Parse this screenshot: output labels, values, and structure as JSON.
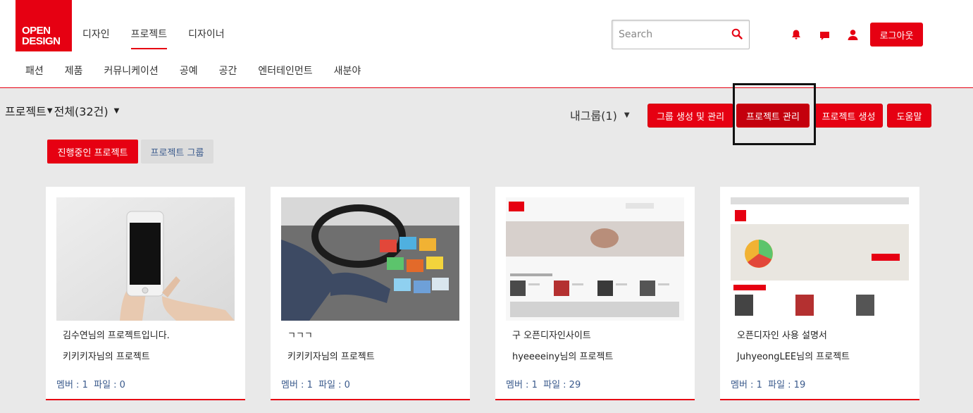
{
  "logo": {
    "line1": "OPEN",
    "line2": "DESIGN"
  },
  "main_nav": [
    {
      "label": "디자인",
      "active": false
    },
    {
      "label": "프로젝트",
      "active": true
    },
    {
      "label": "디자이너",
      "active": false
    }
  ],
  "sub_nav": [
    "패션",
    "제품",
    "커뮤니케이션",
    "공예",
    "공간",
    "엔터테인먼트",
    "새분야"
  ],
  "search": {
    "placeholder": "Search",
    "value": ""
  },
  "header_icons": [
    "bell-icon",
    "chat-icon",
    "user-icon"
  ],
  "logout_label": "로그아웃",
  "crumb": {
    "section": "프로젝트",
    "filter": "전체(32건)"
  },
  "my_group_label": "내그룹(1)",
  "actions": {
    "group_create": "그룹 생성 및 관리",
    "project_manage": "프로젝트 관리",
    "project_create": "프로젝트 생성",
    "help": "도움말"
  },
  "tabs": {
    "active": "진행중인 프로젝트",
    "inactive": "프로젝트 그룹"
  },
  "cards": [
    {
      "title": "김수연님의 프로젝트입니다.",
      "owner": "키키키자님의 프로젝트",
      "members": "멤버 : 1",
      "files": "파일 : 0"
    },
    {
      "title": "ㄱㄱㄱ",
      "owner": "키키키자님의 프로젝트",
      "members": "멤버 : 1",
      "files": "파일 : 0"
    },
    {
      "title": "구 오픈디자인사이트",
      "owner": "hyeeeeiny님의 프로젝트",
      "members": "멤버 : 1",
      "files": "파일 : 29"
    },
    {
      "title": "오픈디자인 사용 설명서",
      "owner": "JuhyeongLEE님의 프로젝트",
      "members": "멤버 : 1",
      "files": "파일 : 19"
    }
  ],
  "colors": {
    "accent": "#e60012",
    "link": "#3a5a8c",
    "page_bg": "#e9e9e9"
  }
}
